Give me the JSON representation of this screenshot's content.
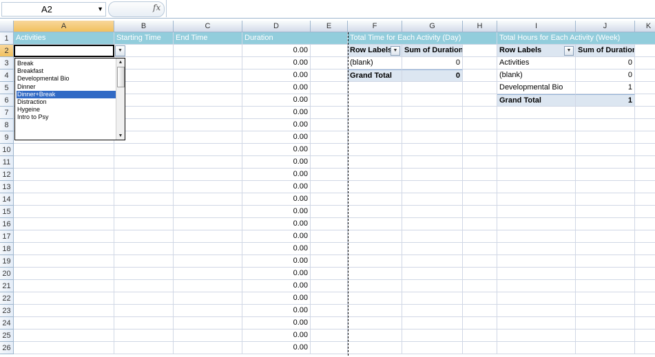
{
  "formula_bar": {
    "name_box": "A2",
    "fx": "fx",
    "formula": ""
  },
  "columns": [
    "A",
    "B",
    "C",
    "D",
    "E",
    "F",
    "G",
    "H",
    "I",
    "J",
    "K"
  ],
  "rows": [
    "1",
    "2",
    "3",
    "4",
    "5",
    "6",
    "7",
    "8",
    "9",
    "10",
    "11",
    "12",
    "13",
    "14",
    "15",
    "16",
    "17",
    "18",
    "19",
    "20",
    "21",
    "22",
    "23",
    "24",
    "25",
    "26"
  ],
  "header_row": {
    "activities": "Activities",
    "starting_time": "Starting Time",
    "end_time": "End Time",
    "duration": "Duration",
    "pivot_day_title": "Total Time for Each Activity (Day)",
    "pivot_week_title": "Total Hours for Each Activity (Week)"
  },
  "duration_values": [
    "0.00",
    "0.00",
    "0.00",
    "0.00",
    "0.00",
    "0.00",
    "0.00",
    "0.00",
    "0.00",
    "0.00",
    "0.00",
    "0.00",
    "0.00",
    "0.00",
    "0.00",
    "0.00",
    "0.00",
    "0.00",
    "0.00",
    "0.00",
    "0.00",
    "0.00",
    "0.00",
    "0.00",
    "0.00"
  ],
  "pivot_day": {
    "row_labels": "Row Labels",
    "sum_label": "Sum of Duration",
    "rows": [
      {
        "label": "(blank)",
        "value": "0"
      }
    ],
    "grand_total_label": "Grand Total",
    "grand_total_value": "0"
  },
  "pivot_week": {
    "row_labels": "Row Labels",
    "sum_label": "Sum of Duration",
    "rows": [
      {
        "label": "Activities",
        "value": "0"
      },
      {
        "label": "(blank)",
        "value": "0"
      },
      {
        "label": "Developmental Bio",
        "value": "1"
      }
    ],
    "grand_total_label": "Grand Total",
    "grand_total_value": "1"
  },
  "dropdown": {
    "options": [
      "Break",
      "Breakfast",
      "Developmental Bio",
      "Dinner",
      "Dinner+Break",
      "Distraction",
      "Hygeine",
      "Intro to Psy"
    ],
    "highlighted": "Dinner+Break",
    "arrow": "▼",
    "scroll_up": "▲",
    "scroll_down": "▼"
  },
  "colors": {
    "header_fill": "#92cddc",
    "pivot_fill": "#dce6f1",
    "selection": "#316ac5"
  }
}
